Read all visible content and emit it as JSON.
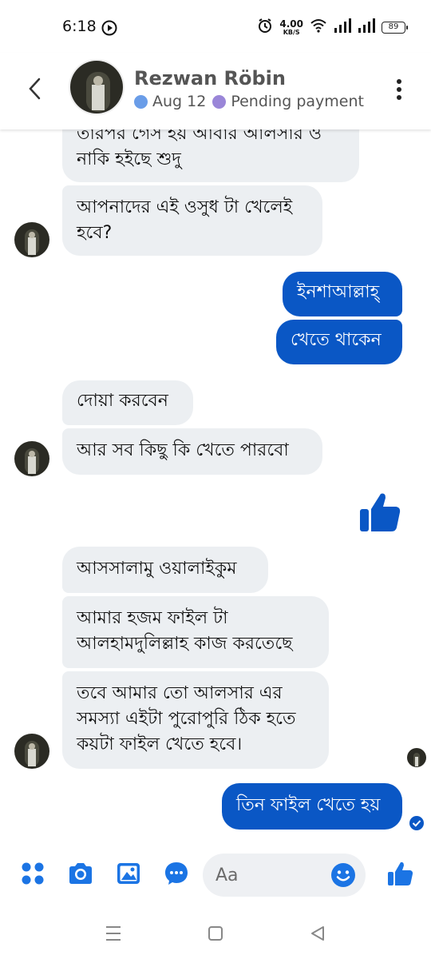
{
  "status_bar": {
    "time": "6:18",
    "net_speed_value": "4.00",
    "net_speed_unit": "KB/S",
    "battery": "89"
  },
  "header": {
    "contact_name": "Rezwan Röbin",
    "date_label": "Aug 12",
    "status_label": "Pending payment"
  },
  "messages": [
    {
      "id": "m1",
      "direction": "in",
      "text": "তারপর গেস হয় আবার আলসার ও নাকি হইছে শুদু"
    },
    {
      "id": "m2",
      "direction": "in",
      "text": "আপনাদের এই ওসুধ টা খেলেই হবে?"
    },
    {
      "id": "m3",
      "direction": "out",
      "text": "ইনশাআল্লাহ্"
    },
    {
      "id": "m4",
      "direction": "out",
      "text": "খেতে থাকেন"
    },
    {
      "id": "m5",
      "direction": "in",
      "text": "দোয়া করবেন"
    },
    {
      "id": "m6",
      "direction": "in",
      "text": "আর সব কিছু কি খেতে পারবো"
    },
    {
      "id": "m7",
      "direction": "out",
      "type": "like",
      "icon": "thumbs-up-icon"
    },
    {
      "id": "m8",
      "direction": "in",
      "text": "আসসালামু ওয়ালাইকুম"
    },
    {
      "id": "m9",
      "direction": "in",
      "text": "আমার হজম ফাইল টা আলহামদুলিল্লাহ কাজ করতেছে"
    },
    {
      "id": "m10",
      "direction": "in",
      "text": "তবে আমার তো আলসার এর সমস্যা এইটা পুরোপুরি ঠিক হতে কয়টা ফাইল খেতে হবে।"
    },
    {
      "id": "m11",
      "direction": "out",
      "text": "তিন ফাইল খেতে হয়"
    }
  ],
  "composer": {
    "placeholder": "Aa",
    "icons": [
      "apps-icon",
      "camera-icon",
      "gallery-icon",
      "chat-bubble-icon",
      "emoji-icon",
      "like-icon"
    ]
  },
  "colors": {
    "accent": "#0a57c5",
    "icon_blue": "#1b74e4",
    "incoming_bubble": "#eceff2",
    "status_dot_blue": "#6a9de8",
    "status_dot_purple": "#9a86d8"
  }
}
